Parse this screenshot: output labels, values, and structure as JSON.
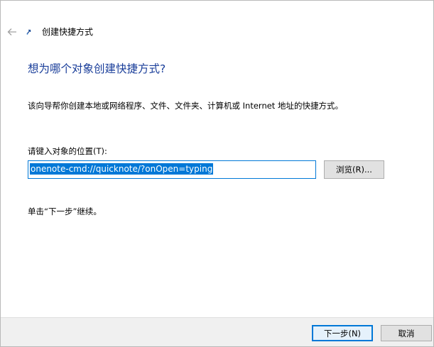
{
  "header": {
    "title": "创建快捷方式"
  },
  "main": {
    "heading": "想为哪个对象创建快捷方式?",
    "description": "该向导帮你创建本地或网络程序、文件、文件夹、计算机或 Internet 地址的快捷方式。",
    "location_label": "请键入对象的位置(T):",
    "location_value": "onenote-cmd://quicknote/?onOpen=typing",
    "browse_label": "浏览(R)...",
    "instruction": "单击“下一步”继续。"
  },
  "footer": {
    "next_label": "下一步(N)",
    "cancel_label": "取消"
  },
  "colors": {
    "heading": "#1a3e9a",
    "accent": "#0078d7",
    "footer_bg": "#f0f0f0"
  },
  "icons": {
    "back": "arrow-left-icon",
    "title": "shortcut-icon"
  }
}
